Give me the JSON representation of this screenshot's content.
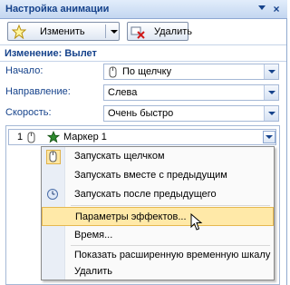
{
  "pane": {
    "title": "Настройка анимации",
    "change_button": "Изменить",
    "delete_button": "Удалить",
    "section_title": "Изменение: Вылет"
  },
  "fields": {
    "start": {
      "label": "Начало:",
      "value": "По щелчку"
    },
    "direction": {
      "label": "Направление:",
      "value": "Слева"
    },
    "speed": {
      "label": "Скорость:",
      "value": "Очень быстро"
    }
  },
  "list": {
    "item": {
      "number": "1",
      "name": "Маркер 1"
    }
  },
  "menu": {
    "items": [
      {
        "label": "Запускать щелчком",
        "icon": "mouse-icon",
        "checked": true
      },
      {
        "label": "Запускать вместе с предыдущим",
        "icon": "",
        "checked": false
      },
      {
        "label": "Запускать после предыдущего",
        "icon": "clock-icon",
        "checked": false
      },
      {
        "label": "Параметры эффектов...",
        "icon": "",
        "checked": false,
        "selected": true
      },
      {
        "label": "Время...",
        "icon": "",
        "checked": false
      },
      {
        "label": "Показать расширенную временную шкалу",
        "icon": "",
        "checked": false
      },
      {
        "label": "Удалить",
        "icon": "",
        "checked": false
      }
    ]
  },
  "colors": {
    "accent": "#15428b",
    "titlebar": "#c3d6f0",
    "highlight": "#ffe9a8"
  }
}
